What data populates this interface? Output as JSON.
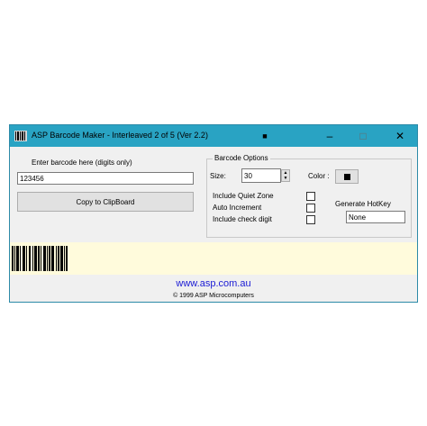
{
  "window": {
    "title": "ASP Barcode Maker - Interleaved 2 of 5 (Ver 2.2)",
    "pin_glyph": "■",
    "minimize_glyph": "–",
    "maximize_glyph": "□",
    "close_glyph": "✕",
    "titlebar_color": "#29a3c3"
  },
  "input": {
    "label": "Enter barcode here (digits only)",
    "value": "123456"
  },
  "copy_button": {
    "label": "Copy to ClipBoard"
  },
  "options": {
    "group_title": "Barcode Options",
    "size_label": "Size:",
    "size_value": "30",
    "color_label": "Color :",
    "color_value": "#000000",
    "quiet_zone_label": "Include Quiet Zone",
    "auto_increment_label": "Auto Increment",
    "check_digit_label": "Include check digit",
    "hotkey_label": "Generate HotKey",
    "hotkey_value": "None"
  },
  "barcode": {
    "background": "#fffbdc",
    "bar_color": "#000000"
  },
  "footer": {
    "link": "www.asp.com.au",
    "copyright": "© 1999 ASP Microcomputers"
  }
}
